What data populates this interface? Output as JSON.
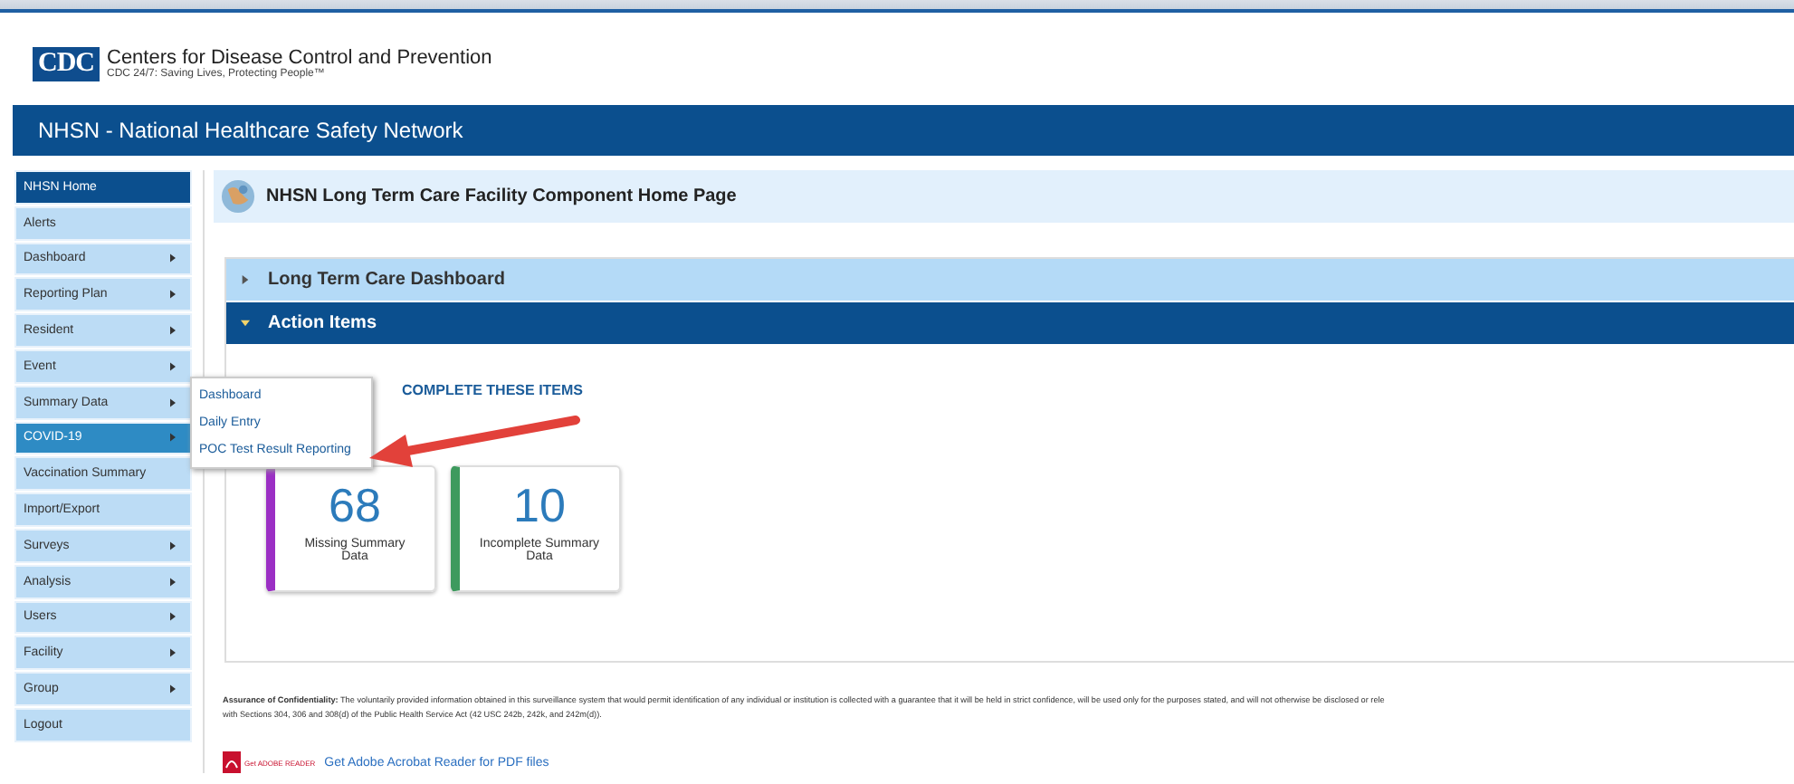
{
  "header": {
    "org": "Centers for Disease Control and Prevention",
    "tagline": "CDC 24/7: Saving Lives, Protecting People™",
    "logo": "CDC"
  },
  "banner": {
    "title": "NHSN - National Healthcare Safety Network"
  },
  "sidebar": {
    "items": [
      {
        "label": "NHSN Home",
        "selected": true,
        "open": false,
        "submenu": false
      },
      {
        "label": "Alerts",
        "selected": false,
        "open": false,
        "submenu": false
      },
      {
        "label": "Dashboard",
        "selected": false,
        "open": false,
        "submenu": true
      },
      {
        "label": "Reporting Plan",
        "selected": false,
        "open": false,
        "submenu": true
      },
      {
        "label": "Resident",
        "selected": false,
        "open": false,
        "submenu": true
      },
      {
        "label": "Event",
        "selected": false,
        "open": false,
        "submenu": true
      },
      {
        "label": "Summary Data",
        "selected": false,
        "open": false,
        "submenu": true
      },
      {
        "label": "COVID-19",
        "selected": false,
        "open": true,
        "submenu": true
      },
      {
        "label": "Vaccination Summary",
        "selected": false,
        "open": false,
        "submenu": false
      },
      {
        "label": "Import/Export",
        "selected": false,
        "open": false,
        "submenu": false
      },
      {
        "label": "Surveys",
        "selected": false,
        "open": false,
        "submenu": true
      },
      {
        "label": "Analysis",
        "selected": false,
        "open": false,
        "submenu": true
      },
      {
        "label": "Users",
        "selected": false,
        "open": false,
        "submenu": true
      },
      {
        "label": "Facility",
        "selected": false,
        "open": false,
        "submenu": true
      },
      {
        "label": "Group",
        "selected": false,
        "open": false,
        "submenu": true
      },
      {
        "label": "Logout",
        "selected": false,
        "open": false,
        "submenu": false
      }
    ]
  },
  "submenu": {
    "items": [
      "Dashboard",
      "Daily Entry",
      "POC Test Result Reporting"
    ]
  },
  "page": {
    "title": "NHSN Long Term Care Facility Component Home Page"
  },
  "sections": [
    {
      "title": "Long Term Care Dashboard",
      "expanded": false
    },
    {
      "title": "Action Items",
      "expanded": true
    }
  ],
  "action_items": {
    "heading": "COMPLETE THESE ITEMS",
    "cards": [
      {
        "count": "68",
        "label": "Missing Summary Data",
        "color": "#9b2fc4"
      },
      {
        "count": "10",
        "label": "Incomplete Summary Data",
        "color": "#3e9a5e"
      }
    ]
  },
  "footer": {
    "confidentiality": "**Assurance of Confidentiality:** The voluntarily provided information obtained in this surveillance system that would permit identification of any individual or institution is collected with a guarantee that it will be held in strict confidence, will be used only for the purposes stated, and will not otherwise be disclosed or rele",
    "confidentiality_2": "with Sections 304, 306 and 308(d) of the Public Health Service Act (42 USC 242b, 242k, and 242m(d)).",
    "adobe_badge": "Get ADOBE READER",
    "adobe_link": "Get Adobe Acrobat Reader for PDF files"
  }
}
